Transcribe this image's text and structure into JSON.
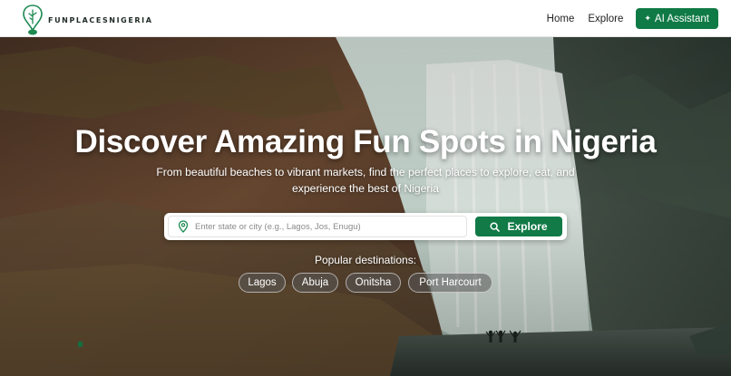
{
  "brand": {
    "name": "FUNPLACESNIGERIA",
    "logo_icon": "map-pin-logo-icon"
  },
  "nav": {
    "home": "Home",
    "explore": "Explore",
    "ai_assistant": "AI Assistant",
    "ai_icon": "sparkle-icon"
  },
  "hero": {
    "title": "Discover Amazing Fun Spots in Nigeria",
    "subtitle": "From beautiful beaches to vibrant markets, find the perfect places to explore, eat, and experience the best of Nigeria"
  },
  "search": {
    "placeholder": "Enter state or city (e.g., Lagos, Jos, Enugu)",
    "value": "",
    "button_label": "Explore",
    "pin_icon": "location-pin-icon",
    "button_icon": "search-icon"
  },
  "popular": {
    "label": "Popular destinations:",
    "destinations": [
      "Lagos",
      "Abuja",
      "Onitsha",
      "Port Harcourt"
    ]
  },
  "colors": {
    "primary_green": "#0f7a45",
    "header_bg": "#ffffff",
    "hero_text": "#ffffff"
  }
}
